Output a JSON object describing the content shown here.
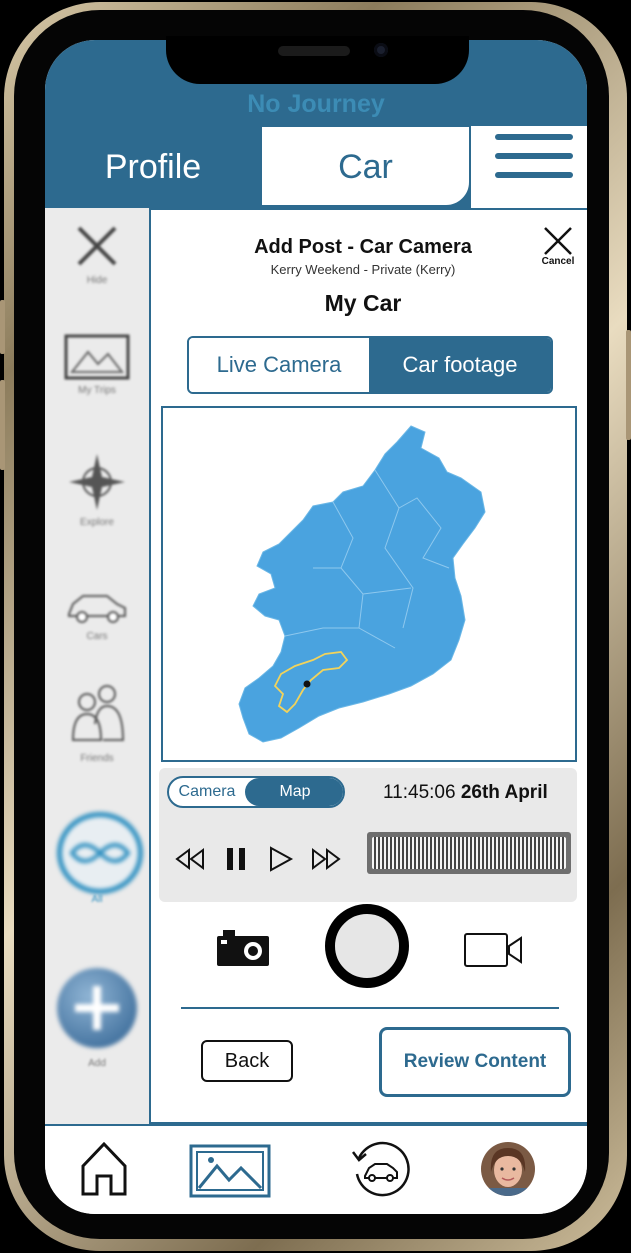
{
  "header": {
    "journey_status": "No Journey",
    "tabs": [
      {
        "label": "Profile",
        "active": false
      },
      {
        "label": "Car",
        "active": true
      }
    ]
  },
  "sidebar": {
    "items": [
      {
        "label": "Hide",
        "icon": "close-icon"
      },
      {
        "label": "My Trips",
        "icon": "image-icon"
      },
      {
        "label": "Explore",
        "icon": "compass-icon"
      },
      {
        "label": "Cars",
        "icon": "car-icon"
      },
      {
        "label": "Friends",
        "icon": "people-icon"
      },
      {
        "label": "All",
        "icon": "infinity-icon"
      },
      {
        "label": "Add",
        "icon": "plus-icon"
      }
    ]
  },
  "panel": {
    "title": "Add Post - Car Camera",
    "subtitle": "Kerry Weekend - Private (Kerry)",
    "heading": "My Car",
    "cancel_label": "Cancel",
    "source_tabs": [
      {
        "label": "Live Camera",
        "active": false
      },
      {
        "label": "Car footage",
        "active": true
      }
    ],
    "map": {
      "region": "Ireland",
      "route_color": "#f2d35b",
      "land_color": "#4aa3df"
    }
  },
  "playback": {
    "view_toggle": [
      {
        "label": "Camera",
        "active": false
      },
      {
        "label": "Map",
        "active": true
      }
    ],
    "time": "11:45:06",
    "date": "26th April",
    "controls": [
      "rewind-icon",
      "pause-icon",
      "play-icon",
      "fast-forward-icon"
    ]
  },
  "capture": {
    "icons": [
      "photo-camera-icon",
      "shutter-button",
      "video-camera-icon"
    ]
  },
  "actions": {
    "back_label": "Back",
    "review_label": "Review Content"
  },
  "bottom_nav": {
    "items": [
      "home-icon",
      "gallery-icon",
      "car-history-icon",
      "profile-avatar"
    ]
  },
  "colors": {
    "brand": "#2d6a8f",
    "sidebar_bg": "#ebebeb",
    "map_land": "#4aa3df"
  }
}
